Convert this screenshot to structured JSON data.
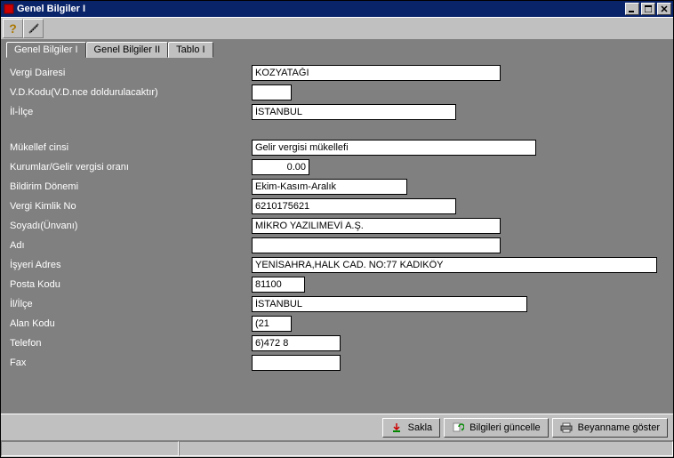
{
  "window": {
    "title": "Genel Bilgiler I"
  },
  "tabs": {
    "tab1": "Genel Bilgiler I",
    "tab2": "Genel Bilgiler II",
    "tab3": "Tablo I"
  },
  "labels": {
    "vergi_dairesi": "Vergi Dairesi",
    "vd_kodu": "V.D.Kodu(V.D.nce doldurulacaktır)",
    "il_ilce": "İl-İlçe",
    "mukellef_cinsi": "Mükellef cinsi",
    "kurumlar_oran": "Kurumlar/Gelir vergisi oranı",
    "bildirim_donemi": "Bildirim Dönemi",
    "vergi_kimlik": "Vergi Kimlik No",
    "soyadi_unvani": "Soyadı(Ünvanı)",
    "adi": "Adı",
    "isyeri_adres": "İşyeri Adres",
    "posta_kodu": "Posta Kodu",
    "il_ilce2": "İl/İlçe",
    "alan_kodu": "Alan Kodu",
    "telefon": "Telefon",
    "fax": "Fax"
  },
  "values": {
    "vergi_dairesi": "KOZYATAĞI",
    "vd_kodu": "",
    "il_ilce": "İSTANBUL",
    "mukellef_cinsi": "Gelir vergisi mükellefi",
    "kurumlar_oran": "0.00",
    "bildirim_donemi": "Ekim-Kasım-Aralık",
    "vergi_kimlik": "6210175621",
    "soyadi_unvani": "MİKRO YAZILIMEVİ A.Ş.",
    "adi": "",
    "isyeri_adres": "YENİSAHRA,HALK CAD. NO:77 KADIKÖY",
    "posta_kodu": "81100",
    "il_ilce2": "İSTANBUL",
    "alan_kodu": "(21",
    "telefon": "6)472 8",
    "fax": ""
  },
  "buttons": {
    "sakla": "Sakla",
    "guncelle": "Bilgileri güncelle",
    "goster": "Beyanname göster"
  }
}
